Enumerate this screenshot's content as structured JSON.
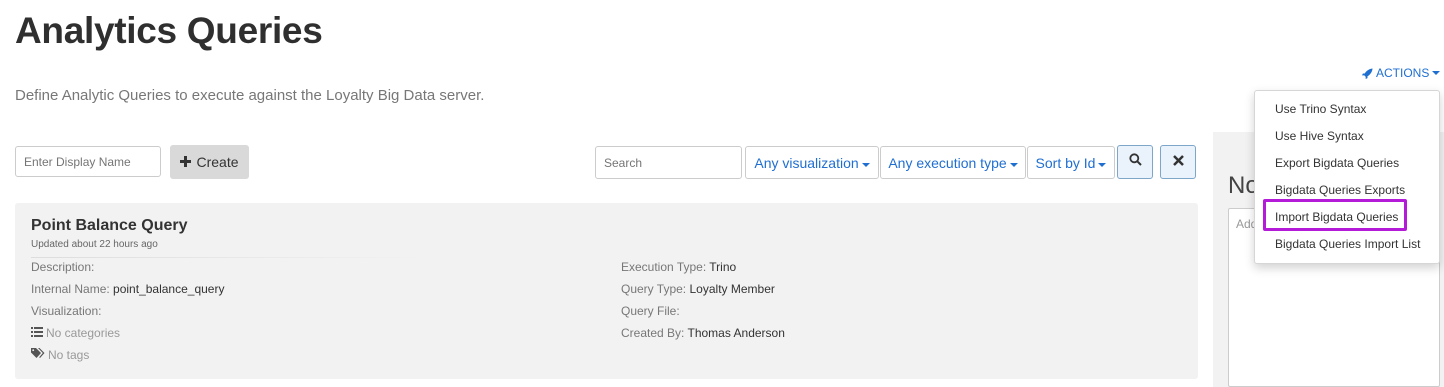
{
  "header": {
    "title": "Analytics Queries",
    "description": "Define Analytic Queries to execute against the Loyalty Big Data server."
  },
  "actions": {
    "label": "ACTIONS",
    "accent_color": "#1f6fd1",
    "icon": "rocket-icon",
    "menu_items": [
      "Use Trino Syntax",
      "Use Hive Syntax",
      "Export Bigdata Queries",
      "Bigdata Queries Exports",
      "Import Bigdata Queries",
      "Bigdata Queries Import List"
    ],
    "highlighted_item": "Import Bigdata Queries",
    "highlight_color": "#b41bd8"
  },
  "create": {
    "placeholder": "Enter Display Name",
    "button_label": "Create",
    "icon": "plus-icon"
  },
  "filters": {
    "search_placeholder": "Search",
    "visualization_label": "Any visualization",
    "execution_type_label": "Any execution type",
    "sort_label": "Sort by Id",
    "search_button_icon": "search-icon",
    "clear_button_icon": "close-icon"
  },
  "side_panel": {
    "heading_partial": "No",
    "textarea_placeholder_partial": "Add"
  },
  "query": {
    "name": "Point Balance Query",
    "updated": "Updated about 22 hours ago",
    "description_label": "Description:",
    "description_value": "",
    "internal_name_label": "Internal Name:",
    "internal_name_value": "point_balance_query",
    "visualization_label": "Visualization:",
    "visualization_value": "",
    "categories_text": "No categories",
    "tags_text": "No tags",
    "execution_type_label": "Execution Type:",
    "execution_type_value": "Trino",
    "query_type_label": "Query Type:",
    "query_type_value": "Loyalty Member",
    "query_file_label": "Query File:",
    "query_file_value": "",
    "created_by_label": "Created By:",
    "created_by_value": "Thomas Anderson"
  }
}
